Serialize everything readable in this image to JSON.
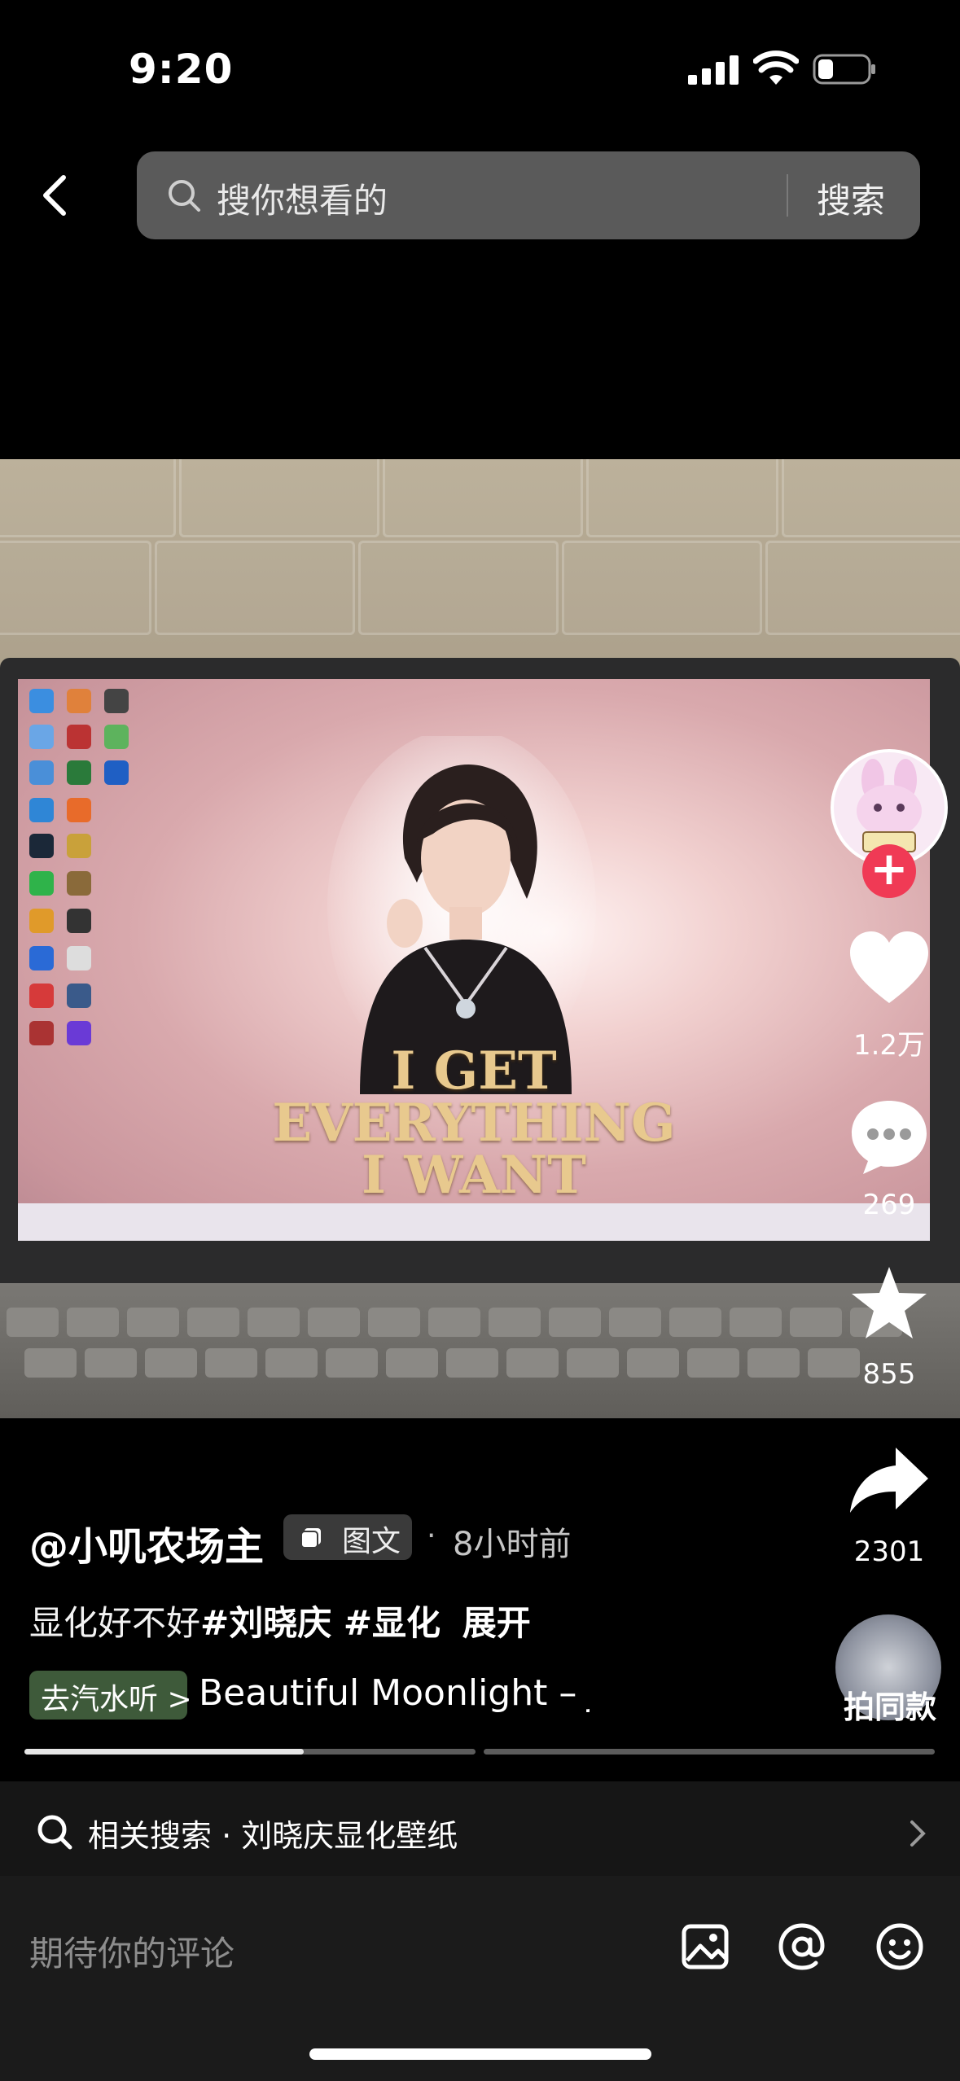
{
  "status_bar": {
    "time": "9:20"
  },
  "search": {
    "back_icon": "chevron-left-icon",
    "placeholder": "搜你想看的",
    "button": "搜索"
  },
  "post": {
    "poster_text": [
      "I GET",
      "EVERYTHING",
      "I WANT"
    ],
    "author": "@小叽农场主",
    "type_tag": "图文",
    "separator": "·",
    "time_ago": "8小时前",
    "caption_text": "显化好不好",
    "caption_tags": "#刘晓庆 #显化",
    "caption_expand": "展开",
    "music_pill": "去汽水听 >",
    "music_title": "Beautiful Moonlight – J",
    "same_style": "拍同款"
  },
  "actions": {
    "like_count": "1.2万",
    "comment_count": "269",
    "favorite_count": "855",
    "share_count": "2301"
  },
  "progress": {
    "current_fraction": 0.62,
    "segments": 2
  },
  "related_search": {
    "label": "相关搜索 · 刘晓庆显化壁纸"
  },
  "comment": {
    "placeholder": "期待你的评论"
  },
  "colors": {
    "follow_red": "#f03a55",
    "background": "#000000",
    "music_pill": "#3e5a3a"
  }
}
